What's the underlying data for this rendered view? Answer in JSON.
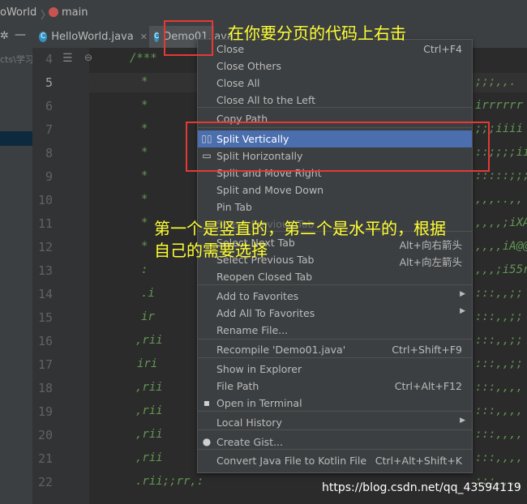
{
  "breadcrumb": {
    "project": "oWorld",
    "module": "main"
  },
  "tabs": [
    {
      "label": "HelloWorld.java"
    },
    {
      "label": "Demo01.java"
    }
  ],
  "left_panel_text": "cts\\学习",
  "line_numbers": [
    "4",
    "5",
    "6",
    "7",
    "8",
    "9",
    "10",
    "11",
    "12",
    "13",
    "14",
    "15",
    "16",
    "17",
    "18",
    "19",
    "20",
    "21",
    "22"
  ],
  "code_lines": [
    "/***",
    "*",
    "*",
    "*",
    "*",
    "*",
    "*",
    "*",
    "*",
    ":",
    ".i",
    "ir",
    ",rii",
    "iri",
    ",rii",
    ",rii",
    ",rii",
    ",rii",
    ".rii;;rr,:"
  ],
  "code_right": [
    "",
    ";;;,,. ",
    "irrrrrr",
    ";;;iiii",
    "::;;;;ii",
    ":::::;;;;",
    ",,,..,,",
    ",,,,;iXA8",
    ",,,,iA@@",
    ",,,;i55r",
    ":::,,;;",
    ":::,,;;",
    ":::,,;;",
    ":::,,;;",
    ":::,,,,",
    ":::,,,,",
    ":::,,,,",
    ":::,,,,",
    ":::,,,,"
  ],
  "context_menu": {
    "items": [
      {
        "label": "Close",
        "shortcut": "Ctrl+F4"
      },
      {
        "label": "Close Others",
        "shortcut": ""
      },
      {
        "label": "Close All",
        "shortcut": ""
      },
      {
        "label": "Close All to the Left",
        "shortcut": ""
      },
      {
        "label": "Copy Path",
        "shortcut": ""
      },
      {
        "label": "Split Vertically",
        "shortcut": ""
      },
      {
        "label": "Split Horizontally",
        "shortcut": ""
      },
      {
        "label": "Split and Move Right",
        "shortcut": ""
      },
      {
        "label": "Split and Move Down",
        "shortcut": ""
      },
      {
        "label": "Pin Tab",
        "shortcut": ""
      },
      {
        "label": "Select Previous Tab",
        "shortcut": ""
      },
      {
        "label": "Select Next Tab",
        "shortcut": "Alt+向右箭头"
      },
      {
        "label": "Select Previous Tab",
        "shortcut": "Alt+向左箭头"
      },
      {
        "label": "Reopen Closed Tab",
        "shortcut": ""
      },
      {
        "label": "Add to Favorites",
        "shortcut": ""
      },
      {
        "label": "Add All To Favorites",
        "shortcut": ""
      },
      {
        "label": "Rename File...",
        "shortcut": ""
      },
      {
        "label": "Recompile 'Demo01.java'",
        "shortcut": "Ctrl+Shift+F9"
      },
      {
        "label": "Show in Explorer",
        "shortcut": ""
      },
      {
        "label": "File Path",
        "shortcut": "Ctrl+Alt+F12"
      },
      {
        "label": "Open in Terminal",
        "shortcut": ""
      },
      {
        "label": "Local History",
        "shortcut": ""
      },
      {
        "label": "Create Gist...",
        "shortcut": ""
      },
      {
        "label": "Convert Java File to Kotlin File",
        "shortcut": "Ctrl+Alt+Shift+K"
      }
    ]
  },
  "annotations": {
    "top": "在你要分页的代码上右击",
    "middle_line1": "第一个是竖直的，第二个是水平的，根据",
    "middle_line2": "自己的需要选择"
  },
  "watermark": "https://blog.csdn.net/qq_43594119",
  "colors": {
    "selection": "#4b6eaf",
    "annotation": "#ffff33",
    "highlight_box": "#e53935",
    "comment": "#629755"
  }
}
